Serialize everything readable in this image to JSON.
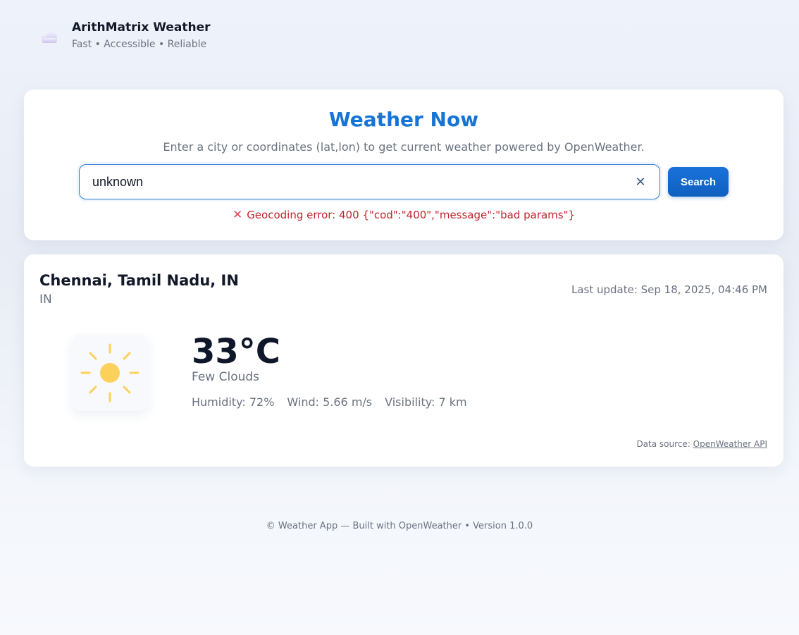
{
  "brand": {
    "title": "ArithMatrix Weather",
    "tagline": "Fast • Accessible • Reliable",
    "logo_icon": "cloud-icon"
  },
  "search": {
    "title": "Weather Now",
    "subtitle": "Enter a city or coordinates (lat,lon) to get current weather powered by OpenWeather.",
    "input_value": "unknown",
    "clear_icon": "close-icon",
    "clear_glyph": "✕",
    "button_label": "Search",
    "error_icon": "error-x-icon",
    "error_glyph": "✕",
    "error_text": "Geocoding error: 400 {\"cod\":\"400\",\"message\":\"bad params\"}"
  },
  "weather": {
    "location": "Chennai, Tamil Nadu, IN",
    "country": "IN",
    "last_update": "Last update: Sep 18, 2025, 04:46 PM",
    "condition_icon": "sun-icon",
    "temperature": "33°C",
    "condition": "Few Clouds",
    "humidity": "Humidity: 72%",
    "wind": "Wind: 5.66 m/s",
    "visibility": "Visibility: 7 km",
    "data_source_prefix": "Data source:",
    "data_source_link": "OpenWeather API"
  },
  "footer": {
    "text": "© Weather App — Built with OpenWeather • Version 1.0.0"
  },
  "colors": {
    "accent": "#1674d6",
    "error": "#c0262d",
    "sun": "#fcd15b"
  }
}
